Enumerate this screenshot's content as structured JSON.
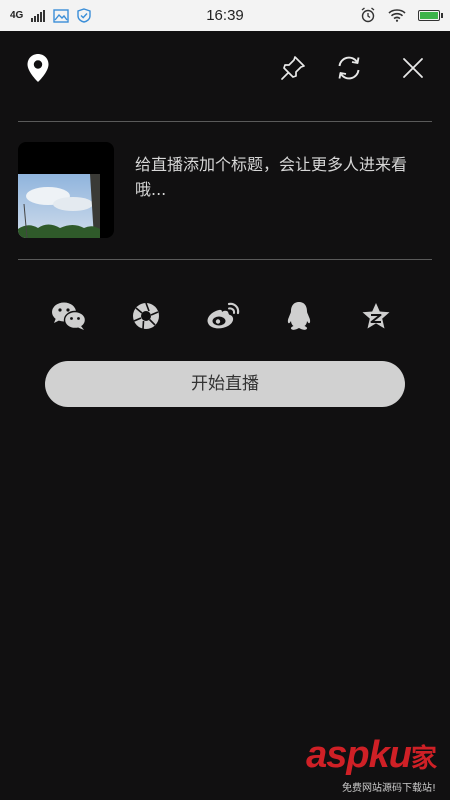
{
  "status_bar": {
    "network": "4G",
    "time": "16:39",
    "battery_level": 1.0
  },
  "topbar": {
    "location_icon": "location-pin-icon",
    "pin_icon": "thumbtack-icon",
    "switch_camera_icon": "refresh-icon",
    "close_icon": "close-icon"
  },
  "cover": {
    "image": "cover-photo-sky-trees"
  },
  "title_hint": "给直播添加个标题，会让更多人进来看哦...",
  "share": [
    {
      "name": "wechat",
      "icon": "wechat-icon"
    },
    {
      "name": "moments",
      "icon": "aperture-icon"
    },
    {
      "name": "weibo",
      "icon": "weibo-icon"
    },
    {
      "name": "qq",
      "icon": "qq-icon"
    },
    {
      "name": "qzone",
      "icon": "qzone-star-icon"
    }
  ],
  "start_button": "开始直播",
  "watermark": {
    "brand": "aspku",
    "cn": "家",
    "tagline": "免费网站源码下载站!"
  },
  "colors": {
    "background": "#111011",
    "button_bg": "#d1d1d1",
    "watermark_red": "#cf2026"
  }
}
